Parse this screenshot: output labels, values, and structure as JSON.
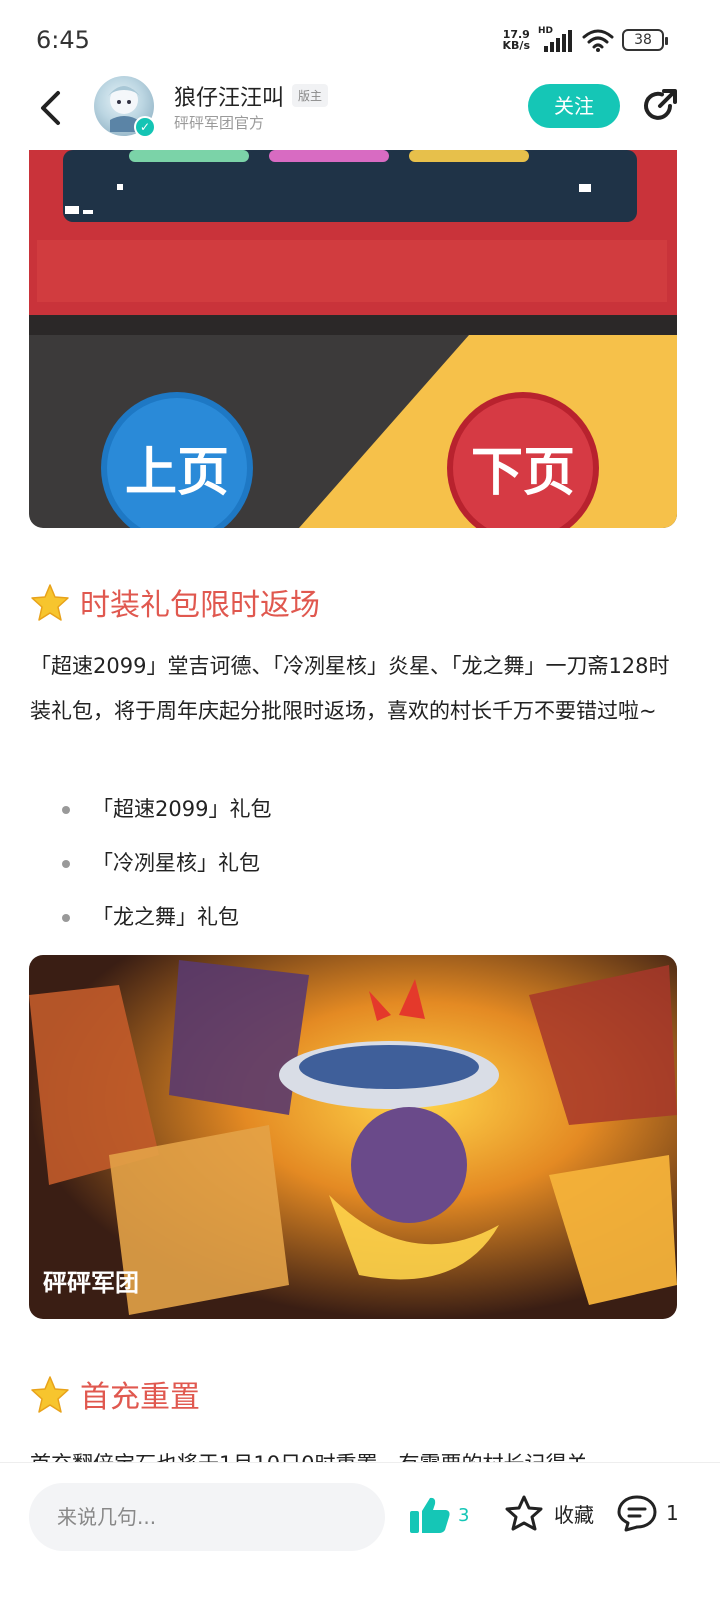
{
  "status_bar": {
    "time": "6:45",
    "net_speed_value": "17.9",
    "net_speed_unit": "KB/s",
    "network_label": "HD",
    "battery": "38"
  },
  "header": {
    "author_name": "狼仔汪汪叫",
    "author_role": "版主",
    "author_org": "砰砰军团官方",
    "follow_label": "关注"
  },
  "images": {
    "top": {
      "button_prev": "上页",
      "button_next": "下页"
    },
    "middle": {
      "logo_text": "砰砰军团"
    }
  },
  "sections": [
    {
      "title": "时装礼包限时返场",
      "paragraph": "「超速2099」堂吉诃德、「冷冽星核」炎星、「龙之舞」一刀斋128时装礼包，将于周年庆起分批限时返场，喜欢的村长千万不要错过啦~",
      "bullets": [
        "「超速2099」礼包",
        "「冷冽星核」礼包",
        "「龙之舞」礼包"
      ]
    },
    {
      "title": "首充重置",
      "paragraph": "首充翻倍宝石也将于1月10日0时重置，有需要的村长记得关"
    }
  ],
  "bottom_bar": {
    "comment_placeholder": "来说几句...",
    "like_count": "3",
    "favorite_label": "收藏",
    "comment_count": "1"
  },
  "colors": {
    "accent": "#15c6b6",
    "section_title": "#e0584f"
  }
}
